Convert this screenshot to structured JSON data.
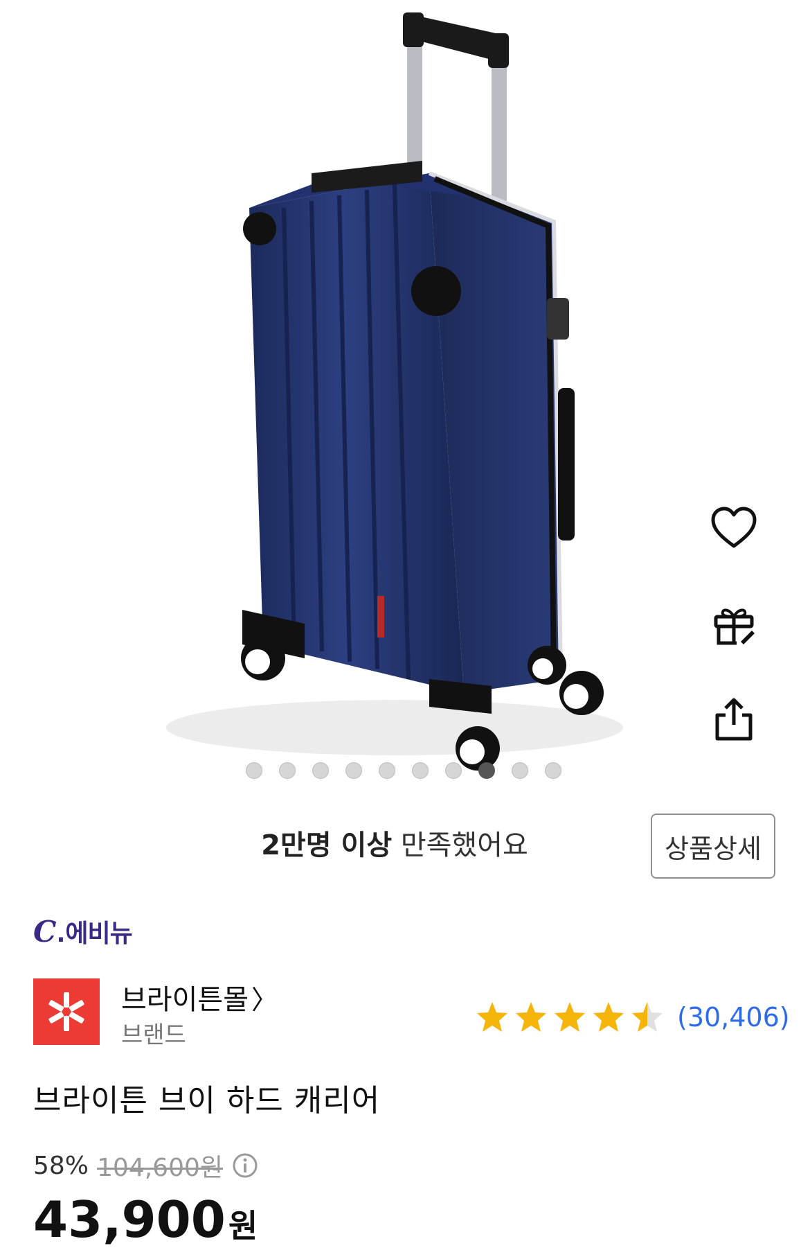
{
  "gallery": {
    "slides_total": 10,
    "active_index": 7
  },
  "actions": {
    "like_icon": "heart-icon",
    "gift_icon": "gift-icon",
    "share_icon": "share-icon"
  },
  "satisfaction": {
    "bold": "2만명 이상",
    "rest": " 만족했어요"
  },
  "detail_button": "상품상세",
  "brand_logo": {
    "c": "C",
    "dot": ".",
    "text": "에비뉴"
  },
  "seller": {
    "name": "브라이튼몰",
    "chevron": "〉",
    "sub": "브랜드"
  },
  "rating": {
    "value": 4.5,
    "max": 5,
    "count": "(30,406)",
    "star_color": "#f5b50a"
  },
  "product": {
    "title": "브라이튼 브이 하드 캐리어",
    "discount": "58%",
    "original_price": "104,600원",
    "price": "43,900",
    "price_unit": "원"
  },
  "colors": {
    "brand": "#3a2a86",
    "seller_icon_bg": "#ec3b35",
    "link_blue": "#2e6be6"
  }
}
